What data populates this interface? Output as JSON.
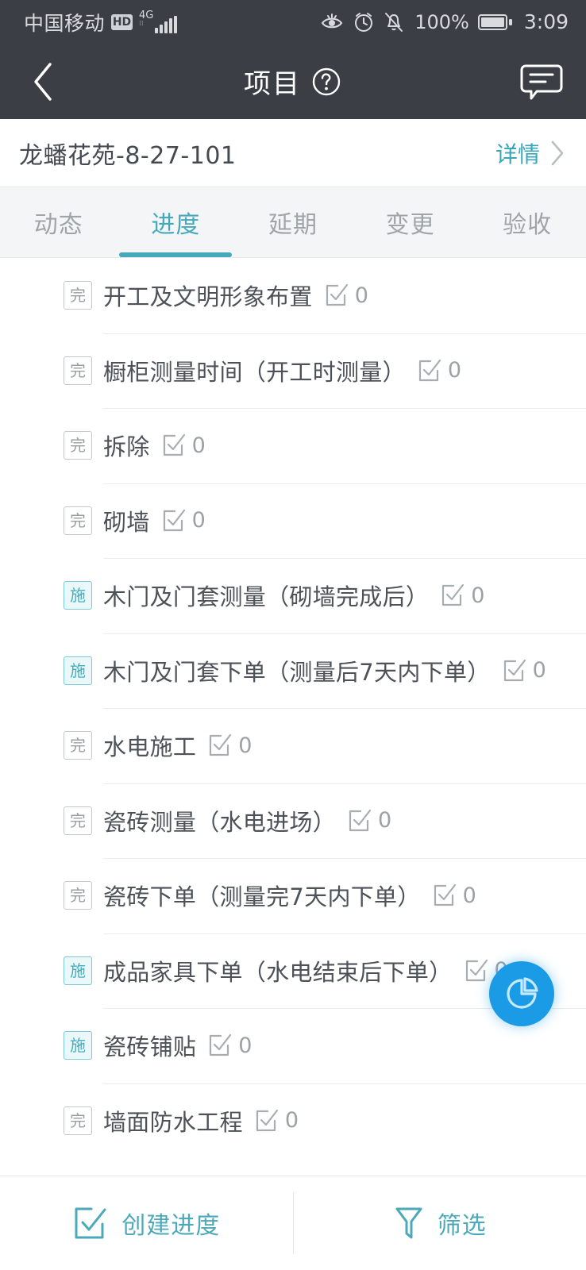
{
  "statusbar": {
    "carrier": "中国移动",
    "hd_label": "HD",
    "network_label": "4G",
    "network_sub": "⁞⁞",
    "battery_percent": "100%",
    "time": "3:09",
    "icons": [
      "eye-comfort-icon",
      "alarm-clock-icon",
      "bell-muted-icon",
      "battery-icon"
    ]
  },
  "header": {
    "back_icon": "chevron-left-icon",
    "title": "项目",
    "help_icon": "question-circle-icon",
    "chat_icon": "chat-bubble-icon",
    "background": "#3b3f45"
  },
  "project": {
    "name": "龙蟠花苑-8-27-101",
    "detail_label": "详情",
    "detail_chevron": "chevron-right-icon",
    "accent": "#37a6b8"
  },
  "tabs": {
    "active_index": 1,
    "accent": "#45a9bb",
    "items": [
      {
        "label": "动态"
      },
      {
        "label": "进度"
      },
      {
        "label": "延期"
      },
      {
        "label": "变更"
      },
      {
        "label": "验收"
      }
    ]
  },
  "list": {
    "status_labels": {
      "done": "完",
      "doing": "施"
    },
    "count_icon": "checkbox-check-icon",
    "rows": [
      {
        "status": "完",
        "state": "done",
        "title": "开工及文明形象布置",
        "count": "0"
      },
      {
        "status": "完",
        "state": "done",
        "title": "橱柜测量时间（开工时测量）",
        "count": "0"
      },
      {
        "status": "完",
        "state": "done",
        "title": "拆除",
        "count": "0"
      },
      {
        "status": "完",
        "state": "done",
        "title": "砌墙",
        "count": "0"
      },
      {
        "status": "施",
        "state": "doing",
        "title": "木门及门套测量（砌墙完成后）",
        "count": "0"
      },
      {
        "status": "施",
        "state": "doing",
        "title": "木门及门套下单（测量后7天内下单）",
        "count": "0"
      },
      {
        "status": "完",
        "state": "done",
        "title": "水电施工",
        "count": "0"
      },
      {
        "status": "完",
        "state": "done",
        "title": "瓷砖测量（水电进场）",
        "count": "0"
      },
      {
        "status": "完",
        "state": "done",
        "title": "瓷砖下单（测量完7天内下单）",
        "count": "0"
      },
      {
        "status": "施",
        "state": "doing",
        "title": "成品家具下单（水电结束后下单）",
        "count": "0"
      },
      {
        "status": "施",
        "state": "doing",
        "title": "瓷砖铺贴",
        "count": "0"
      },
      {
        "status": "完",
        "state": "done",
        "title": "墙面防水工程",
        "count": "0"
      }
    ]
  },
  "fab": {
    "icon": "pie-chart-icon",
    "color": "#1b9ae6"
  },
  "bottombar": {
    "accent": "#4ba9b9",
    "buttons": [
      {
        "label": "创建进度",
        "icon": "checkbox-check-icon"
      },
      {
        "label": "筛选",
        "icon": "filter-funnel-icon"
      }
    ]
  }
}
